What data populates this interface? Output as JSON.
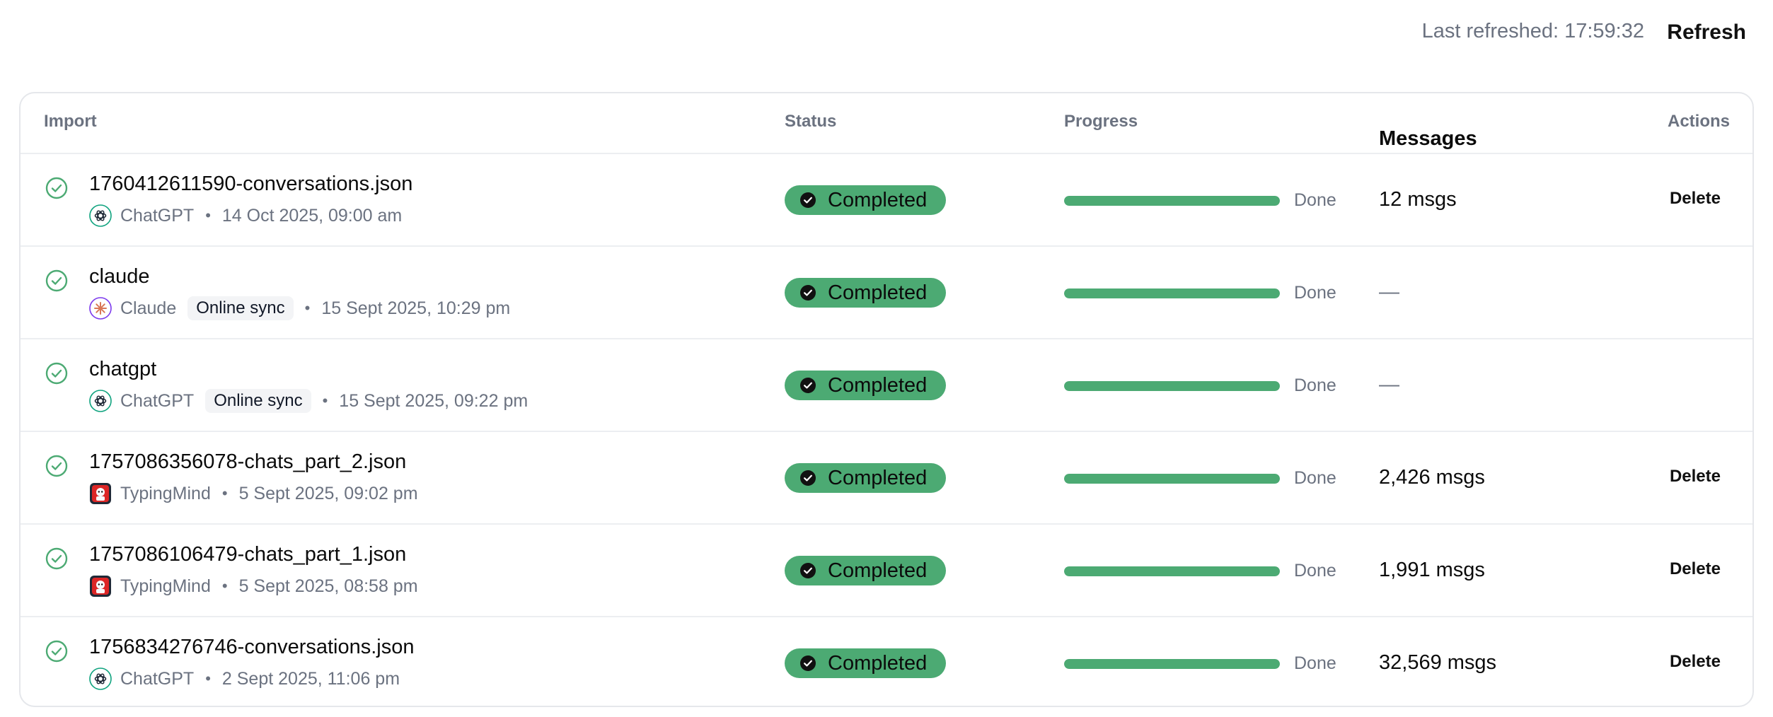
{
  "header": {
    "last_refreshed": "Last refreshed: 17:59:32",
    "refresh_label": "Refresh"
  },
  "table": {
    "columns": {
      "import": "Import",
      "status": "Status",
      "progress": "Progress",
      "messages": "Messages",
      "actions": "Actions"
    },
    "rows": [
      {
        "name": "1760412611590-conversations.json",
        "source": "ChatGPT",
        "source_icon": "chatgpt-icon",
        "badge": "",
        "date": "14 Oct 2025, 09:00 am",
        "status": "Completed",
        "progress_percent": 100,
        "progress_label": "Done",
        "messages": "12 msgs",
        "action": "Delete"
      },
      {
        "name": "claude",
        "source": "Claude",
        "source_icon": "claude-icon",
        "badge": "Online sync",
        "date": "15 Sept 2025, 10:29 pm",
        "status": "Completed",
        "progress_percent": 100,
        "progress_label": "Done",
        "messages": "—",
        "action": ""
      },
      {
        "name": "chatgpt",
        "source": "ChatGPT",
        "source_icon": "chatgpt-icon",
        "badge": "Online sync",
        "date": "15 Sept 2025, 09:22 pm",
        "status": "Completed",
        "progress_percent": 100,
        "progress_label": "Done",
        "messages": "—",
        "action": ""
      },
      {
        "name": "1757086356078-chats_part_2.json",
        "source": "TypingMind",
        "source_icon": "typingmind-icon",
        "badge": "",
        "date": "5 Sept 2025, 09:02 pm",
        "status": "Completed",
        "progress_percent": 100,
        "progress_label": "Done",
        "messages": "2,426 msgs",
        "action": "Delete"
      },
      {
        "name": "1757086106479-chats_part_1.json",
        "source": "TypingMind",
        "source_icon": "typingmind-icon",
        "badge": "",
        "date": "5 Sept 2025, 08:58 pm",
        "status": "Completed",
        "progress_percent": 100,
        "progress_label": "Done",
        "messages": "1,991 msgs",
        "action": "Delete"
      },
      {
        "name": "1756834276746-conversations.json",
        "source": "ChatGPT",
        "source_icon": "chatgpt-icon",
        "badge": "",
        "date": "2 Sept 2025, 11:06 pm",
        "status": "Completed",
        "progress_percent": 100,
        "progress_label": "Done",
        "messages": "32,569 msgs",
        "action": "Delete"
      }
    ]
  },
  "colors": {
    "success": "#4caa73",
    "muted_text": "#6b7280",
    "border": "#e5e7eb",
    "claude_accent": "#d97757",
    "typingmind_accent": "#dc2626"
  }
}
